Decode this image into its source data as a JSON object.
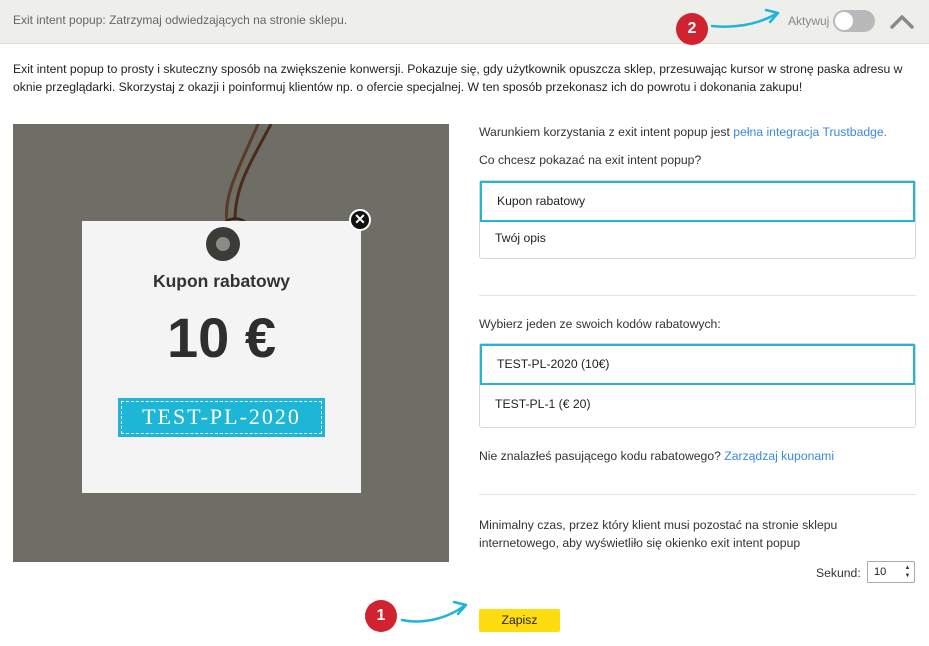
{
  "header": {
    "title": "Exit intent popup: Zatrzymaj odwiedzających na stronie sklepu.",
    "toggle_label": "Aktywuj",
    "toggle_state": "off",
    "collapse_icon": "chevron-up-icon"
  },
  "markers": {
    "save": "1",
    "toggle": "2",
    "color": "#d0232f"
  },
  "intro": "Exit intent popup to prosty i skuteczny sposób na zwiększenie konwersji. Pokazuje się, gdy użytkownik opuszcza sklep, przesuwając kursor w stronę paska adresu w oknie przeglądarki. Skorzystaj z okazji i poinformuj klientów np. o ofercie specjalnej. W ten sposób przekonasz ich do powrotu i dokonania zakupu!",
  "preview": {
    "card_title": "Kupon rabatowy",
    "amount": "10 €",
    "coupon_code": "TEST-PL-2020",
    "close_icon": "close-icon"
  },
  "settings": {
    "requirement_text": "Warunkiem korzystania z exit intent popup jest",
    "requirement_link": "pełna integracja Trustbadge.",
    "content_question": "Co chcesz pokazać na exit intent popup?",
    "content_options": [
      "Kupon rabatowy",
      "Twój opis"
    ],
    "content_selected": "Kupon rabatowy",
    "code_question": "Wybierz jeden ze swoich kodów rabatowych:",
    "code_options": [
      "TEST-PL-2020 (10€)",
      "TEST-PL-1 (€ 20)"
    ],
    "code_selected": "TEST-PL-2020 (10€)",
    "no_match_text": "Nie znalazłeś pasującego kodu rabatowego?",
    "no_match_link": "Zarządzaj kuponami",
    "min_time_text": "Minimalny czas, przez który klient musi pozostać na stronie sklepu internetowego, aby wyświetliło się okienko exit intent popup",
    "seconds_label": "Sekund:",
    "seconds_value": "10"
  },
  "actions": {
    "save_label": "Zapisz"
  },
  "colors": {
    "accent": "#21b6d4",
    "link": "#3c88e0",
    "save": "#ffdc0f",
    "preview_bg": "#6e6d66"
  }
}
